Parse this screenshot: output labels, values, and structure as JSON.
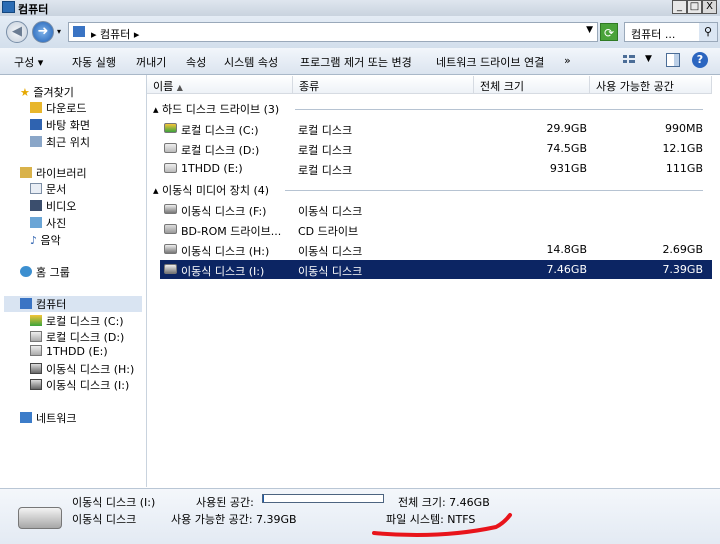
{
  "window": {
    "title": "컴퓨터",
    "min": "_",
    "max": "□",
    "close": "X"
  },
  "address": {
    "crumb": "컴퓨터",
    "search_placeholder": "컴퓨터 ..."
  },
  "toolbar": {
    "items": [
      "구성 ▾",
      "자동 실행",
      "꺼내기",
      "속성",
      "시스템 속성",
      "프로그램 제거 또는 변경",
      "네트워크 드라이브 연결",
      "»"
    ]
  },
  "nav": {
    "favorites": "즐겨찾기",
    "fav_items": [
      "다운로드",
      "바탕 화면",
      "최근 위치"
    ],
    "libraries": "라이브러리",
    "lib_items": [
      "문서",
      "비디오",
      "사진",
      "음악"
    ],
    "homegroup": "홈 그룹",
    "computer": "컴퓨터",
    "computer_items": [
      "로컬 디스크 (C:)",
      "로컬 디스크 (D:)",
      "1THDD (E:)",
      "이동식 디스크 (H:)",
      "이동식 디스크 (I:)"
    ],
    "network": "네트워크"
  },
  "columns": {
    "name": "이름",
    "type": "종류",
    "total": "전체 크기",
    "free": "사용 가능한 공간"
  },
  "groups": [
    {
      "label": "하드 디스크 드라이브 (3)",
      "rows": [
        {
          "name": "로컬 디스크 (C:)",
          "type": "로컬 디스크",
          "total": "29.9GB",
          "free": "990MB"
        },
        {
          "name": "로컬 디스크 (D:)",
          "type": "로컬 디스크",
          "total": "74.5GB",
          "free": "12.1GB"
        },
        {
          "name": "1THDD (E:)",
          "type": "로컬 디스크",
          "total": "931GB",
          "free": "111GB"
        }
      ]
    },
    {
      "label": "이동식 미디어 장치 (4)",
      "rows": [
        {
          "name": "이동식 디스크 (F:)",
          "type": "이동식 디스크",
          "total": "",
          "free": ""
        },
        {
          "name": "BD-ROM 드라이브...",
          "type": "CD 드라이브",
          "total": "",
          "free": ""
        },
        {
          "name": "이동식 디스크 (H:)",
          "type": "이동식 디스크",
          "total": "14.8GB",
          "free": "2.69GB"
        },
        {
          "name": "이동식 디스크 (I:)",
          "type": "이동식 디스크",
          "total": "7.46GB",
          "free": "7.39GB"
        }
      ]
    }
  ],
  "status": {
    "drive_name": "이동식 디스크 (I:)",
    "drive_type": "이동식 디스크",
    "used_label": "사용된 공간:",
    "free_label": "사용 가능한 공간: 7.39GB",
    "total_label": "전체 크기: 7.46GB",
    "fs_label": "파일 시스템: NTFS",
    "used_fraction": 0.01
  },
  "colors": {
    "selection": "#0c2563",
    "annotation": "#e8141b"
  }
}
